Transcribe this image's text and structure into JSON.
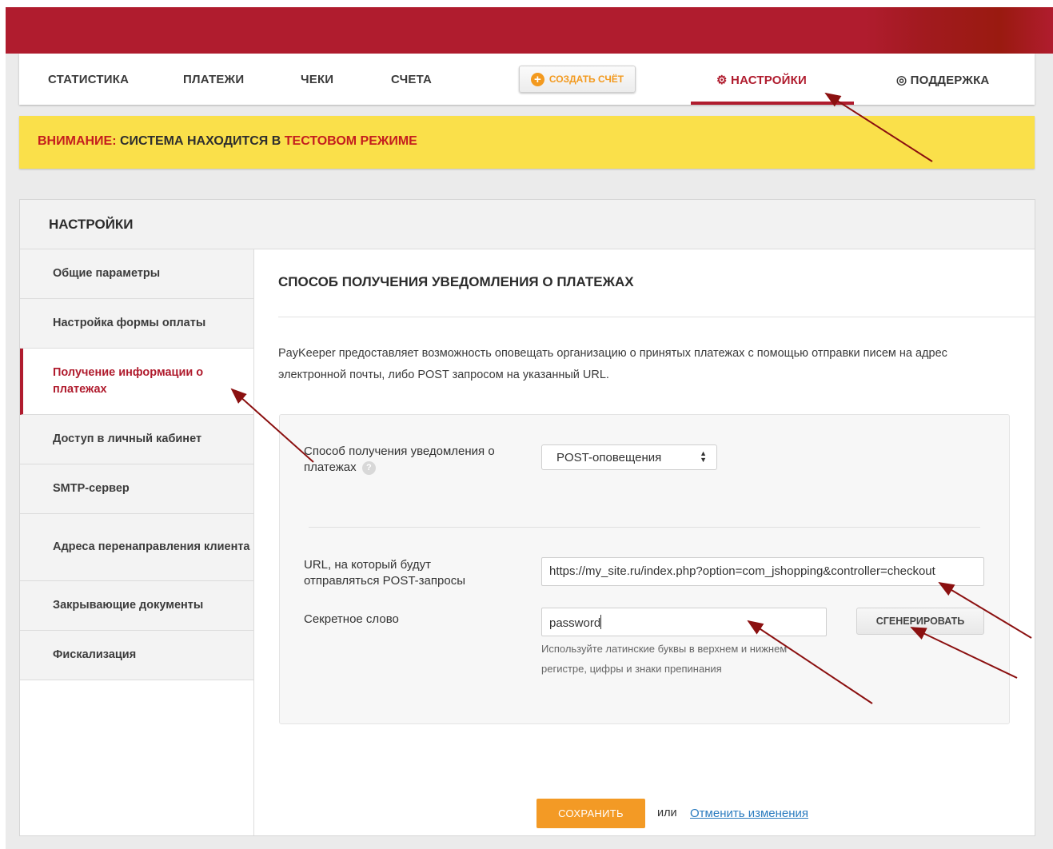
{
  "nav": {
    "items": [
      "СТАТИСТИКА",
      "ПЛАТЕЖИ",
      "ЧЕКИ",
      "СЧЕТА"
    ],
    "create_button": "СОЗДАТЬ СЧЁТ",
    "settings": "НАСТРОЙКИ",
    "support": "ПОДДЕРЖКА"
  },
  "warning": {
    "label": "ВНИМАНИЕ:",
    "text": " СИСТЕМА НАХОДИТСЯ В ",
    "mode": "ТЕСТОВОМ РЕЖИМЕ"
  },
  "panel": {
    "title": "НАСТРОЙКИ"
  },
  "sidebar": {
    "items": [
      {
        "label": "Общие параметры"
      },
      {
        "label": "Настройка формы оплаты"
      },
      {
        "label": "Получение информации о платежах"
      },
      {
        "label": "Доступ в личный кабинет"
      },
      {
        "label": "SMTP-сервер"
      },
      {
        "label": "Адреса перенаправления клиента"
      },
      {
        "label": "Закрывающие документы"
      },
      {
        "label": "Фискализация"
      }
    ]
  },
  "content": {
    "title": "СПОСОБ ПОЛУЧЕНИЯ УВЕДОМЛЕНИЯ О ПЛАТЕЖАХ",
    "description": "PayKeeper предоставляет возможность оповещать организацию о принятых платежах с помощью отправки писем на адрес электронной почты, либо POST запросом на указанный URL.",
    "notify_label": "Способ получения уведомления о платежах",
    "notify_help": "?",
    "notify_value": "POST-оповещения",
    "url_label": "URL, на который будут отправляться POST-запросы",
    "url_value": "https://my_site.ru/index.php?option=com_jshopping&controller=checkout",
    "secret_label": "Секретное слово",
    "secret_value": "password",
    "generate_button": "СГЕНЕРИРОВАТЬ",
    "hint": "Используйте латинские буквы в верхнем и нижнем регистре, цифры и знаки препинания"
  },
  "footer": {
    "save_button": "СОХРАНИТЬ",
    "or": "или",
    "cancel_link": "Отменить изменения"
  },
  "colors": {
    "brand_red": "#b01c2e",
    "warning_yellow": "#fae04a",
    "accent_orange": "#f39a25",
    "link_blue": "#2a7bbf",
    "annotation_arrow": "#8b1010"
  }
}
